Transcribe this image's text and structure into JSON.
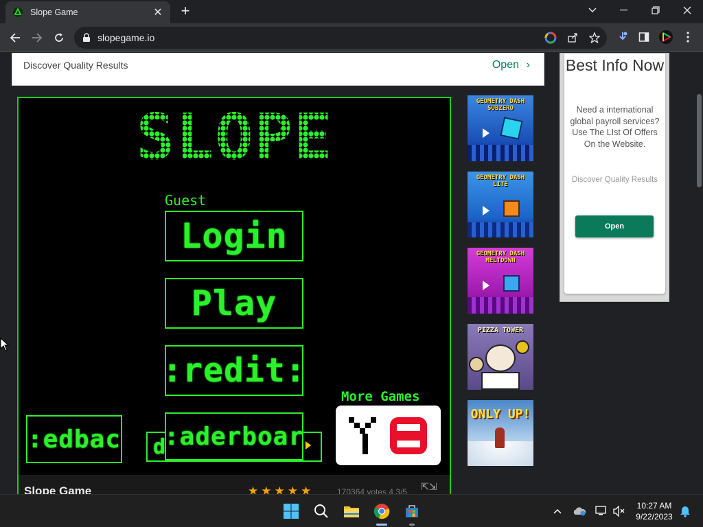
{
  "browser": {
    "tab_title": "Slope Game",
    "tab_close": "✕",
    "new_tab": "+",
    "url": "slopegame.io"
  },
  "ad_top": {
    "text": "Discover Quality Results",
    "open": "Open",
    "chevron": "›"
  },
  "game": {
    "logo": "SLOPE",
    "guest_label": "Guest",
    "buttons": {
      "login": "Login",
      "play": "Play",
      "credits": ":redit:",
      "feedback": ":edbac",
      "hidden": "d",
      "leaderboard": ":aderboar"
    },
    "more_games": "More Games",
    "name": "Slope Game",
    "stars": "★★★★★",
    "votes": "170364 votes 4.3/5",
    "expand": "⇱⇲"
  },
  "thumbnails": [
    {
      "label": "GEOMETRY DASH SUBZERO",
      "bg": "#1a4fb8"
    },
    {
      "label": "GEOMETRY DASH LITE",
      "bg": "#1b63c9"
    },
    {
      "label": "GEOMETRY DASH MELTDOWN",
      "bg": "#b01cb5"
    },
    {
      "label": "PIZZA TOWER",
      "bg": "#6a5a9a"
    },
    {
      "label": "ONLY UP!",
      "bg": "#3a76b9"
    }
  ],
  "ad_right": {
    "title": "Best Info Now",
    "body": "Need a international global payroll services? Use The LIst Of Offers On the Website.",
    "small": "Discover Quality Results",
    "button": "Open"
  },
  "taskbar": {
    "time": "10:27 AM",
    "date": "9/22/2023"
  },
  "colors": {
    "neon_green": "#2cf02c",
    "ad_green": "#0a7a5a",
    "chrome_dark": "#202124",
    "chrome_toolbar": "#35363a"
  }
}
